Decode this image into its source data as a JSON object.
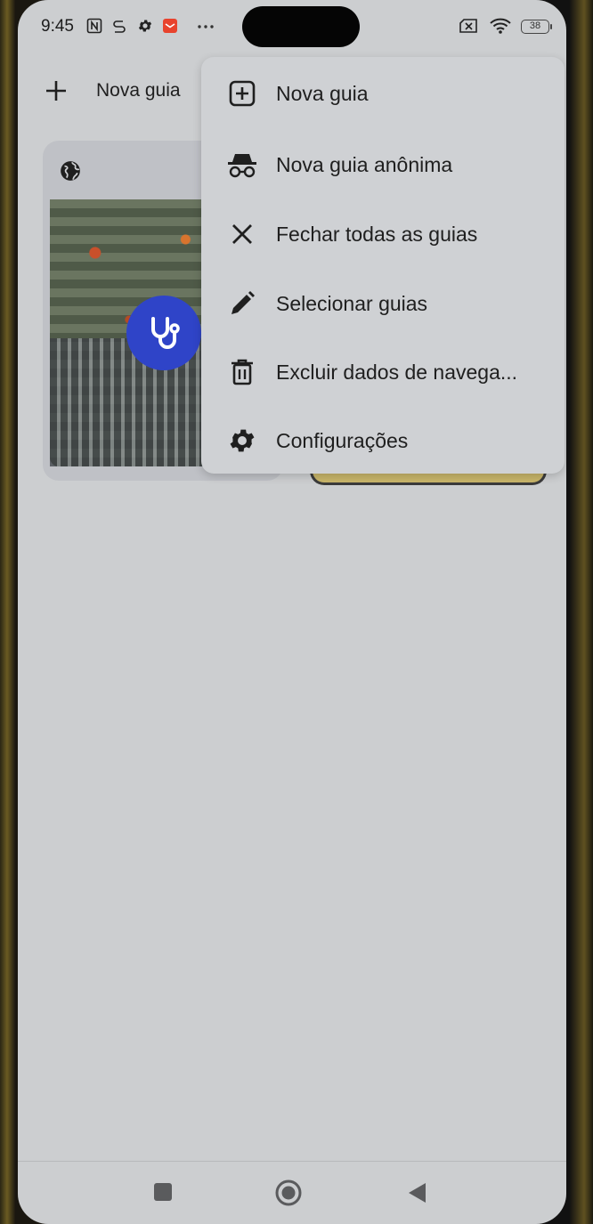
{
  "status_bar": {
    "time": "9:45",
    "battery": "38",
    "icons": [
      "nfc-icon",
      "sync-icon",
      "gear-icon",
      "mail-app-icon",
      "more-dots-icon",
      "sim-off-icon",
      "wifi-icon",
      "battery-icon"
    ]
  },
  "toolbar": {
    "new_tab_label": "Nova guia"
  },
  "menu": {
    "items": [
      {
        "label": "Nova guia",
        "icon": "add-box-icon"
      },
      {
        "label": "Nova guia anônima",
        "icon": "incognito-icon"
      },
      {
        "label": "Fechar todas as guias",
        "icon": "close-icon"
      },
      {
        "label": "Selecionar guias",
        "icon": "pencil-icon"
      },
      {
        "label": "Excluir dados de navega...",
        "icon": "trash-icon"
      },
      {
        "label": "Configurações",
        "icon": "gear-icon"
      }
    ]
  },
  "tabs": [
    {
      "favicon": "globe-icon",
      "badge_icon": "stethoscope-icon",
      "badge_color": "#2f44c8"
    }
  ],
  "nav": {
    "buttons": [
      "recents-button",
      "home-button",
      "back-button"
    ]
  }
}
